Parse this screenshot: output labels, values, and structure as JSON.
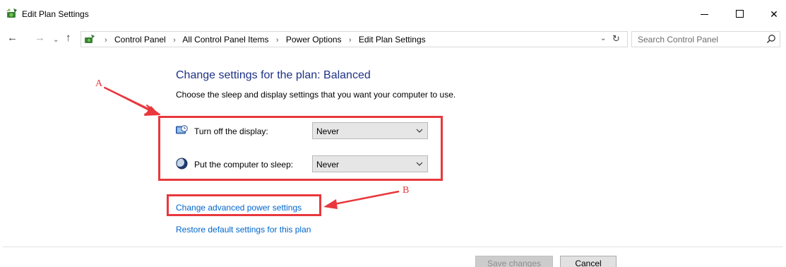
{
  "window": {
    "title": "Edit Plan Settings",
    "controls": {
      "minimize": "minimize",
      "maximize": "maximize",
      "close": "✕"
    }
  },
  "nav": {
    "back": "←",
    "forward": "→",
    "recent": "⌄",
    "up": "↑",
    "breadcrumbs": [
      "Control Panel",
      "All Control Panel Items",
      "Power Options",
      "Edit Plan Settings"
    ],
    "separator": "›",
    "address_dropdown": "⌄",
    "refresh": "↻"
  },
  "search": {
    "placeholder": "Search Control Panel"
  },
  "main": {
    "heading": "Change settings for the plan: Balanced",
    "subtitle": "Choose the sleep and display settings that you want your computer to use.",
    "settings": [
      {
        "label": "Turn off the display:",
        "value": "Never",
        "icon": "display-timer-icon"
      },
      {
        "label": "Put the computer to sleep:",
        "value": "Never",
        "icon": "sleep-moon-icon"
      }
    ],
    "links": {
      "advanced": "Change advanced power settings",
      "restore": "Restore default settings for this plan"
    }
  },
  "footer": {
    "save": "Save changes",
    "cancel": "Cancel"
  },
  "annotations": {
    "a": "A",
    "b": "B",
    "color": "#e8383d"
  },
  "colors": {
    "heading": "#1e3287",
    "link": "#0066cc"
  }
}
